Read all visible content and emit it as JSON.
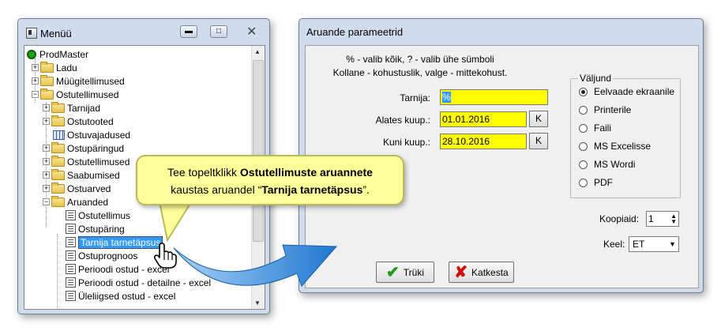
{
  "menu_window": {
    "title": "Menüü",
    "tree": [
      {
        "label": "ProdMaster",
        "level": 0,
        "icon": "root-icon"
      },
      {
        "label": "Ladu",
        "level": 1,
        "icon": "folder-icon",
        "expander": "+"
      },
      {
        "label": "Müügitellimused",
        "level": 1,
        "icon": "folder-icon",
        "expander": "+"
      },
      {
        "label": "Ostutellimused",
        "level": 1,
        "icon": "folder-open-icon",
        "expander": "−"
      },
      {
        "label": "Tarnijad",
        "level": 2,
        "icon": "folder-icon",
        "expander": "+"
      },
      {
        "label": "Ostutooted",
        "level": 2,
        "icon": "folder-icon",
        "expander": "+"
      },
      {
        "label": "Ostuvajadused",
        "level": 2,
        "icon": "grid-icon"
      },
      {
        "label": "Ostupäringud",
        "level": 2,
        "icon": "folder-icon",
        "expander": "+"
      },
      {
        "label": "Ostutellimused",
        "level": 2,
        "icon": "folder-icon",
        "expander": "+"
      },
      {
        "label": "Saabumised",
        "level": 2,
        "icon": "folder-icon",
        "expander": "+"
      },
      {
        "label": "Ostuarved",
        "level": 2,
        "icon": "folder-icon",
        "expander": "+"
      },
      {
        "label": "Aruanded",
        "level": 2,
        "icon": "folder-open-icon",
        "expander": "−"
      },
      {
        "label": "Ostutellimus",
        "level": 3,
        "icon": "report-icon"
      },
      {
        "label": "Ostupäring",
        "level": 3,
        "icon": "report-icon"
      },
      {
        "label": "Tarnija tarnetäpsus",
        "level": 3,
        "icon": "report-icon",
        "selected": true
      },
      {
        "label": "Ostuprognoos",
        "level": 3,
        "icon": "report-icon"
      },
      {
        "label": "Perioodi ostud - excel",
        "level": 3,
        "icon": "report-icon"
      },
      {
        "label": "Perioodi ostud - detailne - excel",
        "level": 3,
        "icon": "report-icon"
      },
      {
        "label": "Üleliigsed ostud - excel",
        "level": 3,
        "icon": "report-icon"
      }
    ]
  },
  "dialog": {
    "title": "Aruande parameetrid",
    "hint_line1": "% - valib kõik, ? - valib ühe sümboli",
    "hint_line2": "Kollane - kohustuslik, valge - mittekohust.",
    "fields": {
      "tarnija_label": "Tarnija:",
      "tarnija_value": "%",
      "alates_label": "Alates kuup.:",
      "alates_value": "01.01.2016",
      "kuni_label": "Kuni kuup.:",
      "kuni_value": "28.10.2016",
      "k_button": "K"
    },
    "output_group": {
      "title": "Väljund",
      "options": [
        "Eelvaade ekraanile",
        "Printerile",
        "Faili",
        "MS Excelisse",
        "MS Wordi",
        "PDF"
      ],
      "selected": "Eelvaade ekraanile"
    },
    "koopiaid_label": "Koopiaid:",
    "koopiaid_value": "1",
    "keel_label": "Keel:",
    "keel_value": "ET",
    "print_button": "Trüki",
    "cancel_button": "Katkesta"
  },
  "callout": {
    "text_pre": "Tee topeltklikk ",
    "text_bold1": "Ostutellimuste aruannete",
    "text_mid": "kaustas aruandel  “",
    "text_bold2": "Tarnija tarnetäpsus",
    "text_post": "”."
  },
  "colors": {
    "required_field": "#ffff00",
    "callout_bg": "#ffff99",
    "selection": "#3399ff",
    "arrow": "#2c7fd6"
  }
}
